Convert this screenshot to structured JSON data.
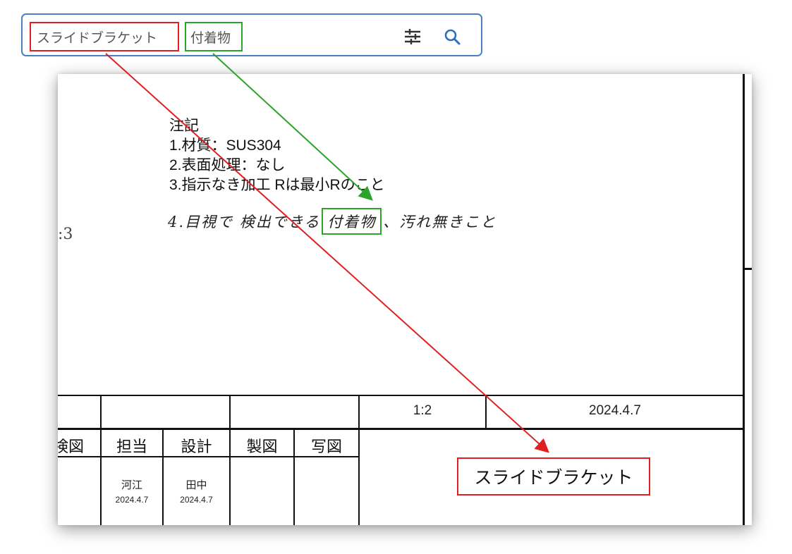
{
  "search": {
    "chip_part_name": "スライドブラケット",
    "chip_keyword": "付着物",
    "filter_icon": "sliders-icon",
    "search_icon": "magnifier-icon"
  },
  "drawing": {
    "left_partial_char": ":3",
    "notes": {
      "heading": "注記",
      "line1": "1.材質：SUS304",
      "line2": "2.表面処理：なし",
      "line3": "3.指示なき加工 Rは最小Rのこと",
      "handwritten_prefix": "4.目視で 検出できる",
      "handwritten_highlight": "付着物",
      "handwritten_suffix": "、汚れ無きこと"
    },
    "title_block": {
      "scale": "1:2",
      "date": "2024.4.7",
      "headers": [
        "検図",
        "担当",
        "設計",
        "製図",
        "写図"
      ],
      "tanto_name": "河江",
      "tanto_date": "2024.4.7",
      "sekkei_name": "田中",
      "sekkei_date": "2024.4.7",
      "part_title": "スライドブラケット"
    }
  },
  "colors": {
    "red_highlight": "#e02020",
    "green_highlight": "#2aa52a",
    "search_border": "#4a7fc1"
  }
}
